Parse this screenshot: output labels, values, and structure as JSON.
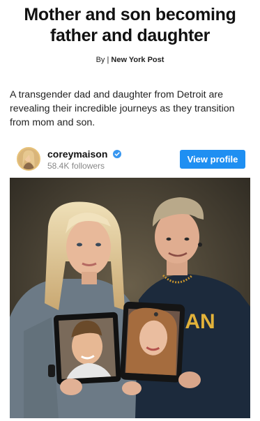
{
  "article": {
    "headline_line1": "Mother and son becoming",
    "headline_line2": "father and daughter",
    "byline_prefix": "By |",
    "byline_source": "New York Post",
    "summary": "A transgender dad and daughter from Detroit are revealing their incredible journeys as they transition from mom and son."
  },
  "instagram": {
    "username": "coreymaison",
    "followers": "58.4K followers",
    "view_profile_label": "View profile",
    "verified_icon": "verified-check-icon",
    "accent_color": "#1f8ff2"
  },
  "photo": {
    "shirt_text": "IAN"
  }
}
